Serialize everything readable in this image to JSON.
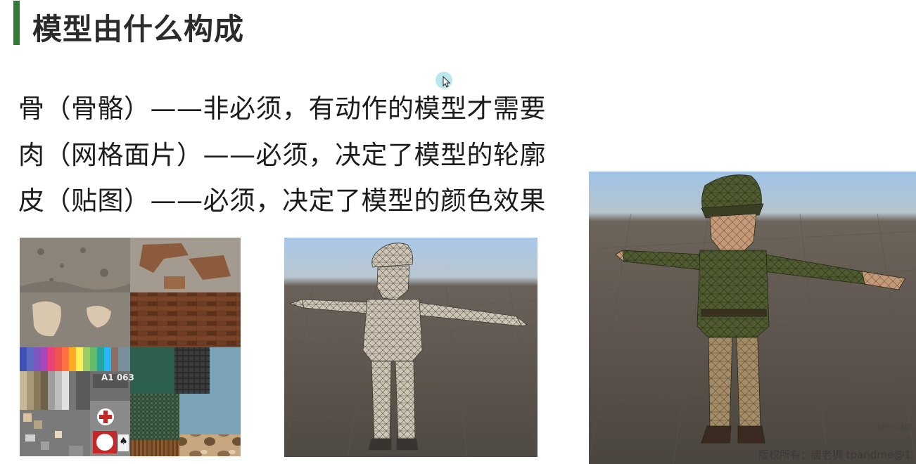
{
  "slide": {
    "title": "模型由什么构成",
    "bullets": [
      "骨（骨骼）——非必须，有动作的模型才需要",
      "肉（网格面片）——必须，决定了模型的轮廓",
      "皮（贴图）——必须，决定了模型的颜色效果"
    ],
    "texture_label": "A1 063",
    "corner_label": "SPECIALT",
    "watermark": "版权所有：唐老狮 tpandme@1",
    "accent_color": "#2e7d32"
  },
  "icons": {
    "cursor": "mouse-pointer-icon",
    "first_aid": "red-cross-icon",
    "card": "spade-card-icon"
  }
}
